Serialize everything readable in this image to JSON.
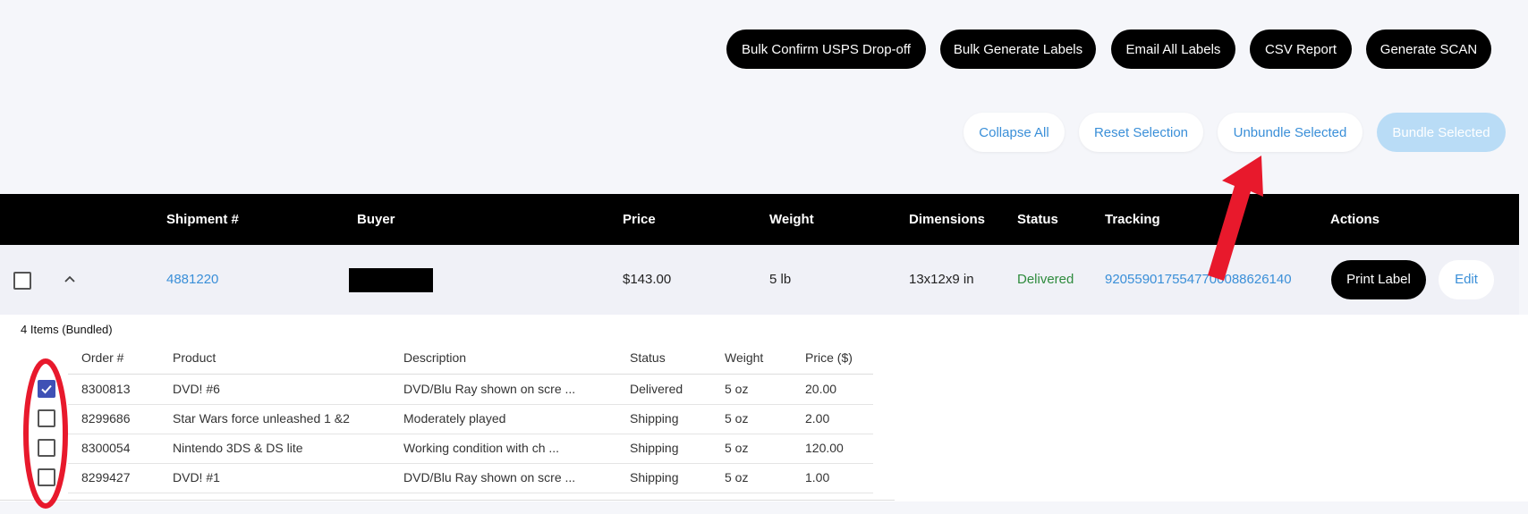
{
  "toolbar_top": {
    "bulk_confirm": "Bulk Confirm USPS Drop-off",
    "bulk_generate": "Bulk Generate Labels",
    "email_all": "Email All Labels",
    "csv_report": "CSV Report",
    "generate_scan": "Generate SCAN"
  },
  "toolbar_selection": {
    "collapse_all": "Collapse All",
    "reset_selection": "Reset Selection",
    "unbundle_selected": "Unbundle Selected",
    "bundle_selected": "Bundle Selected"
  },
  "table": {
    "headers": {
      "shipment": "Shipment #",
      "buyer": "Buyer",
      "price": "Price",
      "weight": "Weight",
      "dimensions": "Dimensions",
      "status": "Status",
      "tracking": "Tracking",
      "actions": "Actions"
    },
    "shipment": {
      "id": "4881220",
      "price": "$143.00",
      "weight": "5 lb",
      "dimensions": "13x12x9 in",
      "status": "Delivered",
      "tracking": "9205590175547700088626140",
      "print_label": "Print Label",
      "edit": "Edit"
    }
  },
  "bundle": {
    "title": "4 Items (Bundled)",
    "headers": {
      "order": "Order #",
      "product": "Product",
      "description": "Description",
      "status": "Status",
      "weight": "Weight",
      "price": "Price ($)"
    },
    "items": [
      {
        "order": "8300813",
        "product": "DVD! #6",
        "description": "DVD/Blu Ray shown on scre ...",
        "status": "Delivered",
        "weight": "5 oz",
        "price": "20.00",
        "checked": true
      },
      {
        "order": "8299686",
        "product": "Star Wars force unleashed 1 &2",
        "description": "Moderately played",
        "status": "Shipping",
        "weight": "5 oz",
        "price": "2.00",
        "checked": false
      },
      {
        "order": "8300054",
        "product": "Nintendo 3DS & DS lite",
        "description": "Working condition with ch ...",
        "status": "Shipping",
        "weight": "5 oz",
        "price": "120.00",
        "checked": false
      },
      {
        "order": "8299427",
        "product": "DVD! #1",
        "description": "DVD/Blu Ray shown on scre ...",
        "status": "Shipping",
        "weight": "5 oz",
        "price": "1.00",
        "checked": false
      }
    ]
  },
  "colors": {
    "accent": "#3a8fd8",
    "delivered": "#2e8b3d",
    "annotation": "#e8192c"
  }
}
